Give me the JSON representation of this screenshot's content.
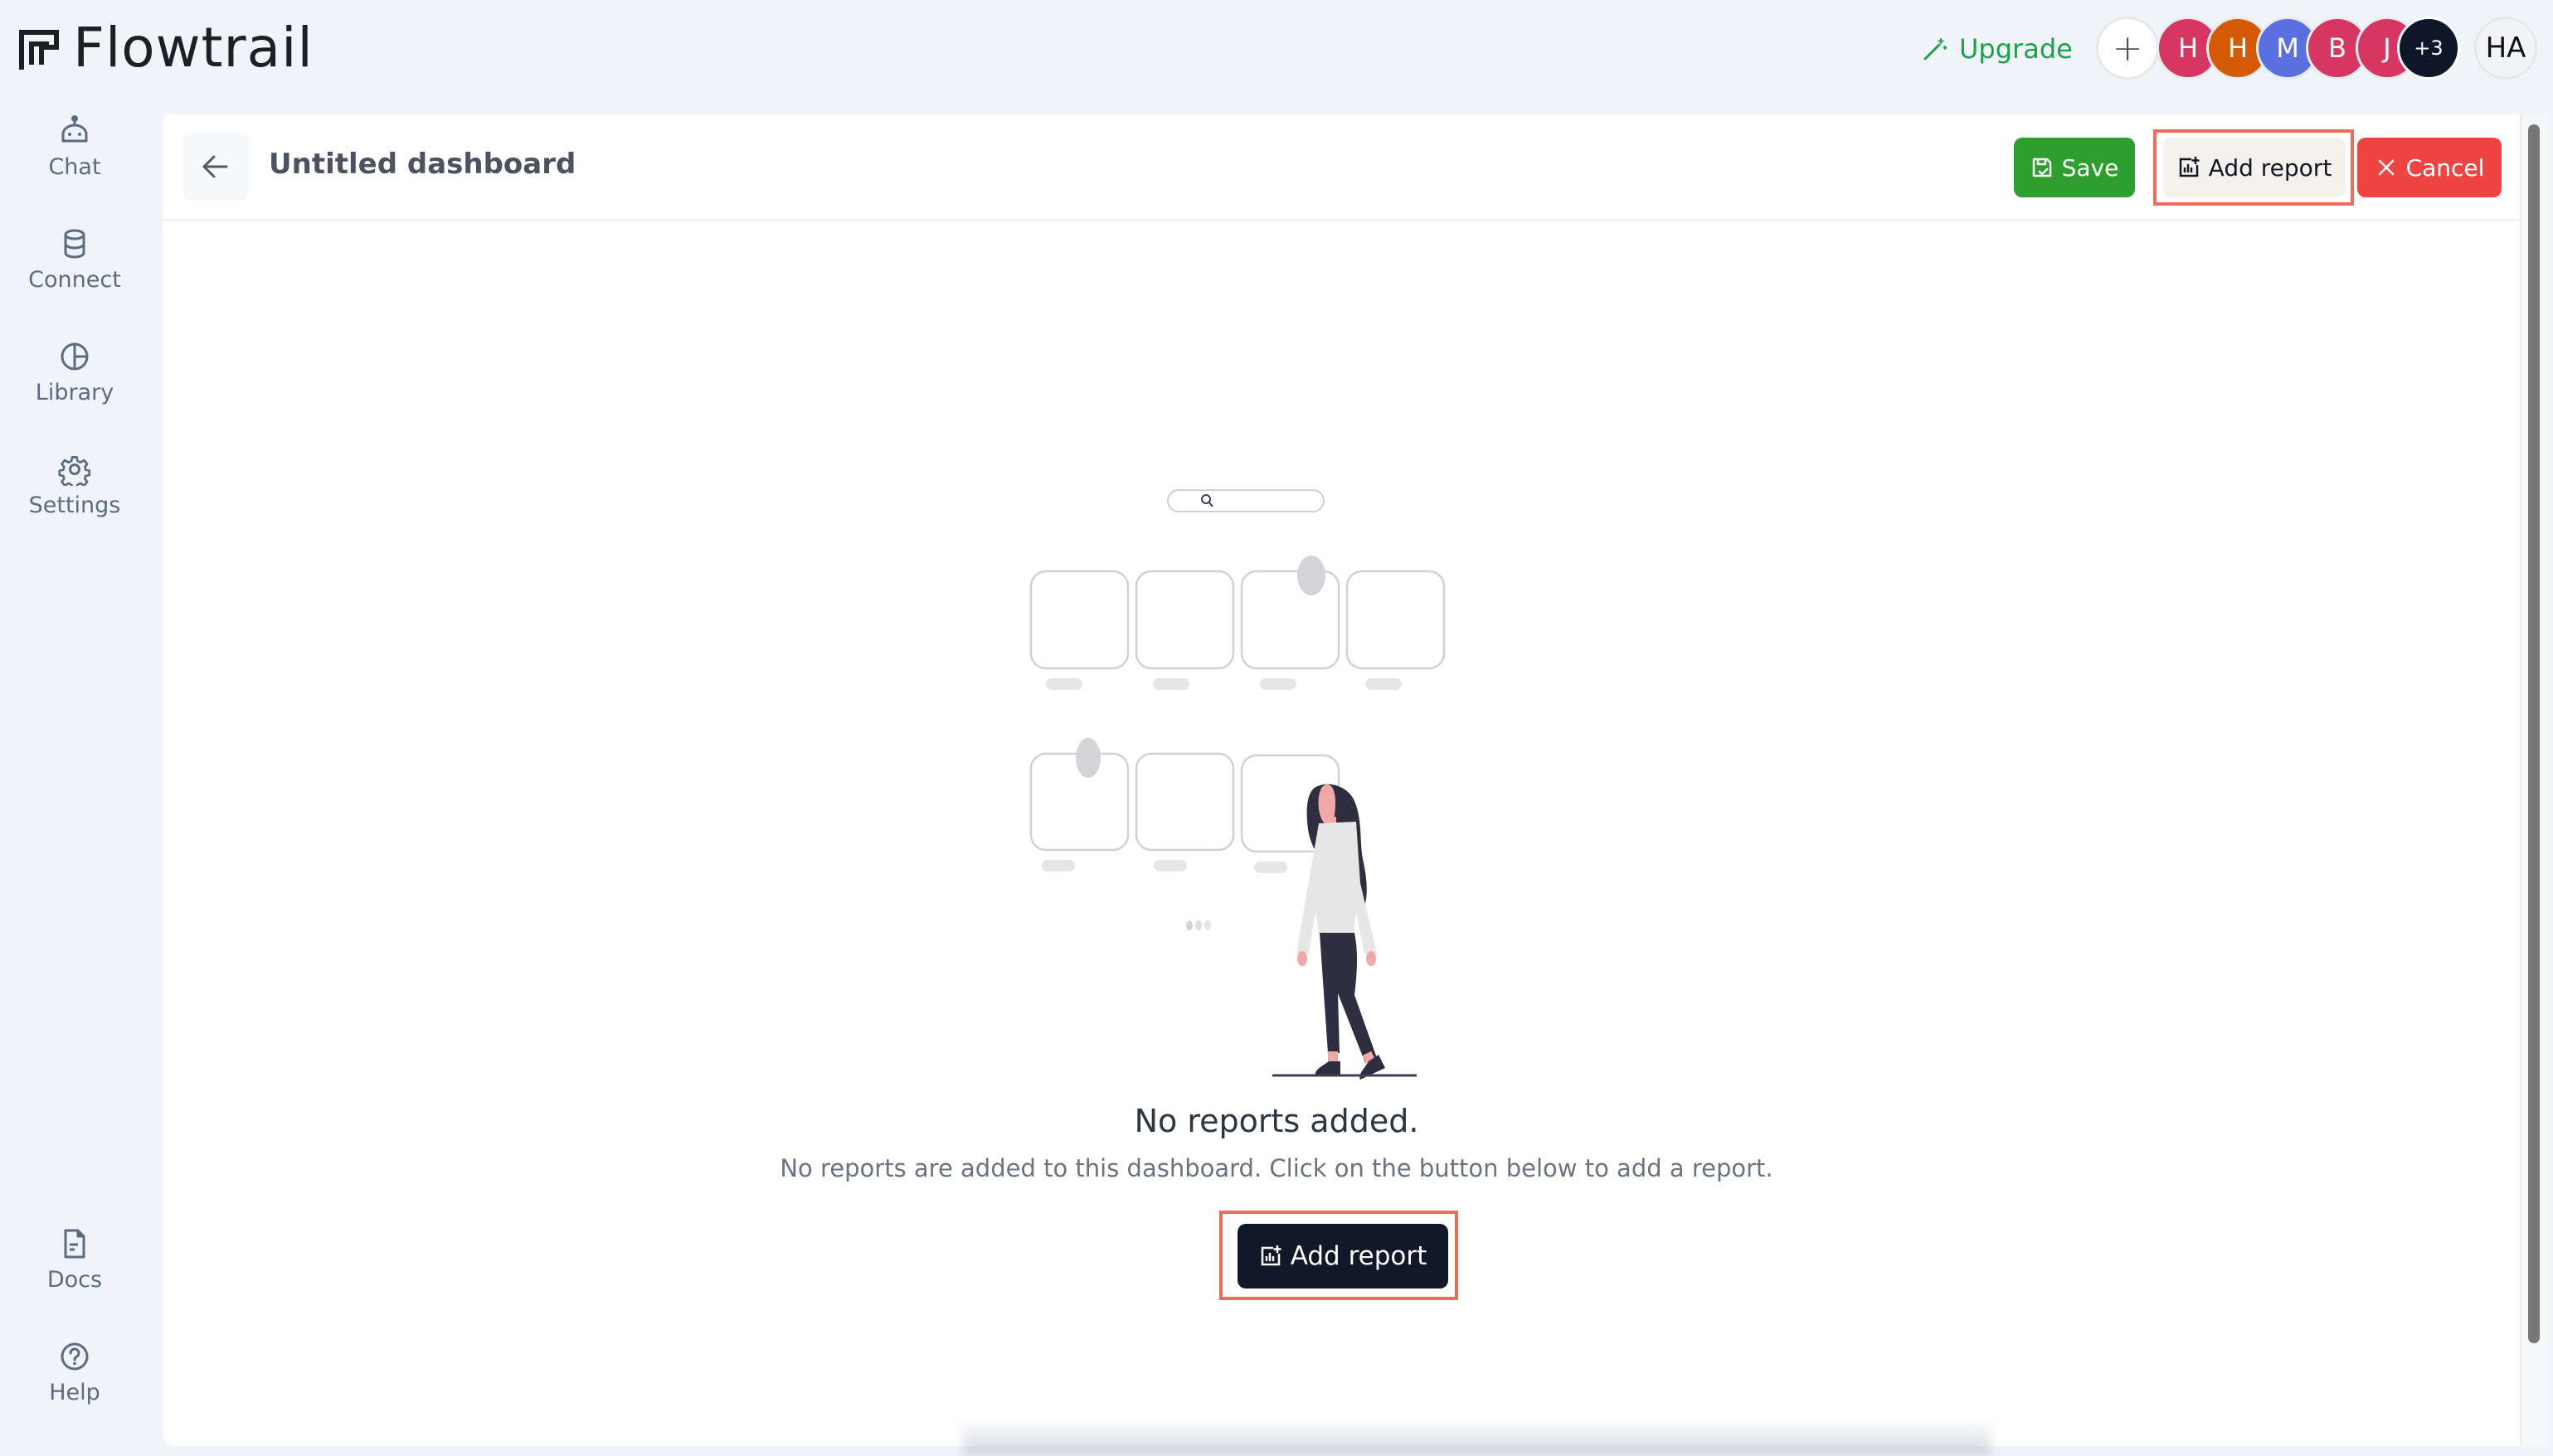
{
  "app": {
    "name": "Flowtrail"
  },
  "topbar": {
    "upgrade_label": "Upgrade",
    "add_member_symbol": "+",
    "members": [
      {
        "initial": "H",
        "color": "#d6365f"
      },
      {
        "initial": "H",
        "color": "#d65a06"
      },
      {
        "initial": "M",
        "color": "#5a70e0"
      },
      {
        "initial": "B",
        "color": "#d6365f"
      },
      {
        "initial": "J",
        "color": "#d6365f"
      }
    ],
    "more_members": "+3",
    "current_user_initials": "HA"
  },
  "sidebar": {
    "items": [
      {
        "label": "Chat",
        "icon": "robot-icon"
      },
      {
        "label": "Connect",
        "icon": "database-icon"
      },
      {
        "label": "Library",
        "icon": "chart-pie-icon"
      },
      {
        "label": "Settings",
        "icon": "gear-icon"
      }
    ],
    "bottom_items": [
      {
        "label": "Docs",
        "icon": "document-icon"
      },
      {
        "label": "Help",
        "icon": "help-circle-icon"
      }
    ]
  },
  "dashboard": {
    "title": "Untitled dashboard",
    "save_label": "Save",
    "add_report_label": "Add report",
    "cancel_label": "Cancel"
  },
  "empty_state": {
    "title": "No reports added.",
    "subtitle": "No reports are added to this dashboard. Click on the button below to add a report.",
    "button_label": "Add report"
  },
  "colors": {
    "save": "#2d9f2f",
    "cancel": "#ef4444",
    "primary_dark": "#111827",
    "upgrade": "#16a34a",
    "highlight": "#ef6b5b"
  }
}
